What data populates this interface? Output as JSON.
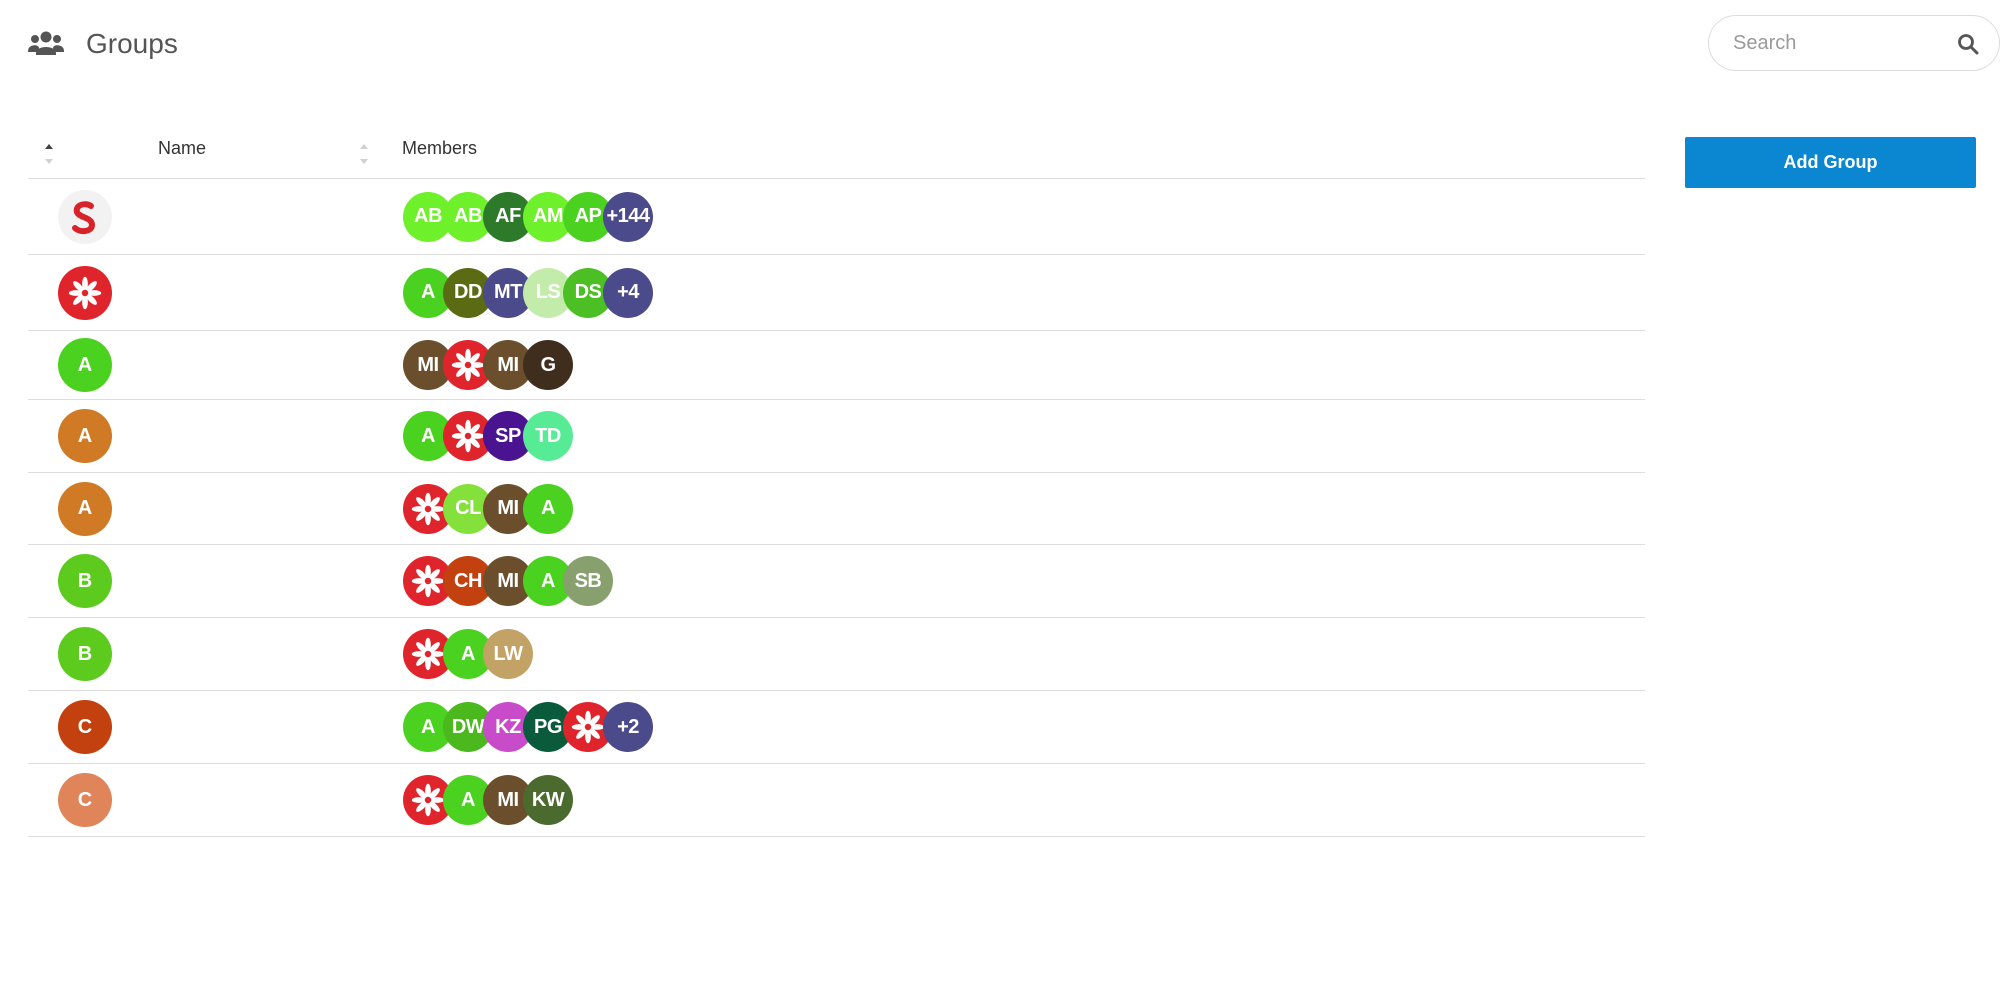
{
  "header": {
    "title": "Groups",
    "icon": "users-icon"
  },
  "search": {
    "placeholder": "Search",
    "value": ""
  },
  "actions": {
    "add_group_label": "Add Group"
  },
  "colors": {
    "accent": "#0a87d0",
    "logo_red": "#e0242c"
  },
  "table": {
    "columns": {
      "name": "Name",
      "members": "Members"
    },
    "rows": [
      {
        "avatar": {
          "type": "logo-s",
          "label": "",
          "color": "#f2f2f2"
        },
        "members": [
          {
            "type": "text",
            "label": "AB",
            "color": "#6ef02a"
          },
          {
            "type": "text",
            "label": "AB",
            "color": "#6ef02a"
          },
          {
            "type": "text",
            "label": "AF",
            "color": "#2c7a2a"
          },
          {
            "type": "text",
            "label": "AM",
            "color": "#6ef02a"
          },
          {
            "type": "text",
            "label": "AP",
            "color": "#4bd11f"
          },
          {
            "type": "text",
            "label": "+144",
            "color": "#4b4a8a"
          }
        ]
      },
      {
        "avatar": {
          "type": "logo-flower",
          "label": "",
          "color": "#e0242c"
        },
        "members": [
          {
            "type": "text",
            "label": "A",
            "color": "#4bd11f"
          },
          {
            "type": "text",
            "label": "DD",
            "color": "#5a6b14"
          },
          {
            "type": "text",
            "label": "MT",
            "color": "#4b4a8a"
          },
          {
            "type": "text",
            "label": "LS",
            "color": "#c3ecaa"
          },
          {
            "type": "text",
            "label": "DS",
            "color": "#4bbf23"
          },
          {
            "type": "text",
            "label": "+4",
            "color": "#4b4a8a"
          }
        ]
      },
      {
        "avatar": {
          "type": "text",
          "label": "A",
          "color": "#4bd11f"
        },
        "members": [
          {
            "type": "text",
            "label": "MI",
            "color": "#6b4f2c"
          },
          {
            "type": "logo-flower",
            "label": "",
            "color": "#e0242c"
          },
          {
            "type": "text",
            "label": "MI",
            "color": "#6b4f2c"
          },
          {
            "type": "text",
            "label": "G",
            "color": "#3f2d1d"
          }
        ]
      },
      {
        "avatar": {
          "type": "text",
          "label": "A",
          "color": "#d07a26"
        },
        "members": [
          {
            "type": "text",
            "label": "A",
            "color": "#4bd11f"
          },
          {
            "type": "logo-flower",
            "label": "",
            "color": "#e0242c"
          },
          {
            "type": "text",
            "label": "SP",
            "color": "#4a138f"
          },
          {
            "type": "text",
            "label": "TD",
            "color": "#58eb96"
          }
        ]
      },
      {
        "avatar": {
          "type": "text",
          "label": "A",
          "color": "#d07a26"
        },
        "members": [
          {
            "type": "logo-flower",
            "label": "",
            "color": "#e0242c"
          },
          {
            "type": "text",
            "label": "CL",
            "color": "#84e03a"
          },
          {
            "type": "text",
            "label": "MI",
            "color": "#6b4f2c"
          },
          {
            "type": "text",
            "label": "A",
            "color": "#4bd11f"
          }
        ]
      },
      {
        "avatar": {
          "type": "text",
          "label": "B",
          "color": "#5ccb1e"
        },
        "members": [
          {
            "type": "logo-flower",
            "label": "",
            "color": "#e0242c"
          },
          {
            "type": "text",
            "label": "CH",
            "color": "#c3400f"
          },
          {
            "type": "text",
            "label": "MI",
            "color": "#6b4f2c"
          },
          {
            "type": "text",
            "label": "A",
            "color": "#4bd11f"
          },
          {
            "type": "text",
            "label": "SB",
            "color": "#87a06d"
          }
        ]
      },
      {
        "avatar": {
          "type": "text",
          "label": "B",
          "color": "#5ccb1e"
        },
        "members": [
          {
            "type": "logo-flower",
            "label": "",
            "color": "#e0242c"
          },
          {
            "type": "text",
            "label": "A",
            "color": "#4bd11f"
          },
          {
            "type": "text",
            "label": "LW",
            "color": "#c2a265"
          }
        ]
      },
      {
        "avatar": {
          "type": "text",
          "label": "C",
          "color": "#c3400f"
        },
        "members": [
          {
            "type": "text",
            "label": "A",
            "color": "#4bd11f"
          },
          {
            "type": "text",
            "label": "DW",
            "color": "#4bb81e"
          },
          {
            "type": "text",
            "label": "KZ",
            "color": "#c84cc9"
          },
          {
            "type": "text",
            "label": "PG",
            "color": "#0a5a3c"
          },
          {
            "type": "logo-flower",
            "label": "",
            "color": "#e0242c"
          },
          {
            "type": "text",
            "label": "+2",
            "color": "#4b4a8a"
          }
        ]
      },
      {
        "avatar": {
          "type": "text",
          "label": "C",
          "color": "#e0845a"
        },
        "members": [
          {
            "type": "logo-flower",
            "label": "",
            "color": "#e0242c"
          },
          {
            "type": "text",
            "label": "A",
            "color": "#4bd11f"
          },
          {
            "type": "text",
            "label": "MI",
            "color": "#6b4f2c"
          },
          {
            "type": "text",
            "label": "KW",
            "color": "#4a6b2d"
          }
        ]
      }
    ]
  }
}
